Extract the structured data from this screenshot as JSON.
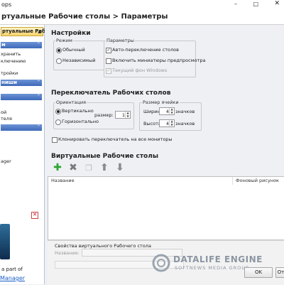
{
  "window": {
    "title": "ops"
  },
  "header": {
    "text": "ртуальные Рабочие столы > Параметры"
  },
  "left": {
    "active_section": "ртуальные Рабочие с…",
    "section1": {
      "title": "м",
      "items": [
        "хранить",
        "ключению",
        "",
        "тройки"
      ]
    },
    "section2": {
      "title": "ниши",
      "items": []
    },
    "section3": {
      "title": "",
      "items": [
        "ой",
        "теля"
      ]
    },
    "section4": {
      "title": "",
      "items": [
        "ager"
      ]
    },
    "ad": {
      "text": "a part of",
      "link": "Manager"
    }
  },
  "settings": {
    "title": "Настройки",
    "mode_label": "Режим",
    "mode_normal": "Обычный",
    "mode_independent": "Независимый",
    "params_label": "Параметры",
    "auto_switch": "Авто-переключение столов",
    "thumbs": "Включить миниатюры предпросмотра",
    "wallpaper": "Текущий фон Windows"
  },
  "switcher": {
    "title": "Переключатель Рабочих столов",
    "orientation_label": "Ориентация",
    "vertical": "Вертикально",
    "horizontal": "Горизонтально",
    "size_label": "размер:",
    "size_value": "1",
    "cell_size_label": "Размер ячейки",
    "width_label": "Ширина:",
    "width_value": "4",
    "height_label": "Высота:",
    "height_value": "4",
    "unit": "значков",
    "clone": "Клонировать переключатель на все мониторы"
  },
  "desktops": {
    "title": "Виртуальные Рабочие столы",
    "col_name": "Название",
    "col_wallpaper": "Фоновый рисунок"
  },
  "props": {
    "title": "Свойства виртуального Рабочего стола",
    "name_label": "Название:"
  },
  "buttons": {
    "ok": "OK",
    "cancel": "Отм"
  },
  "watermark": {
    "line1": "DATALIFE ENGINE",
    "line2": "SOFTNEWS MEDIA GROUP"
  }
}
